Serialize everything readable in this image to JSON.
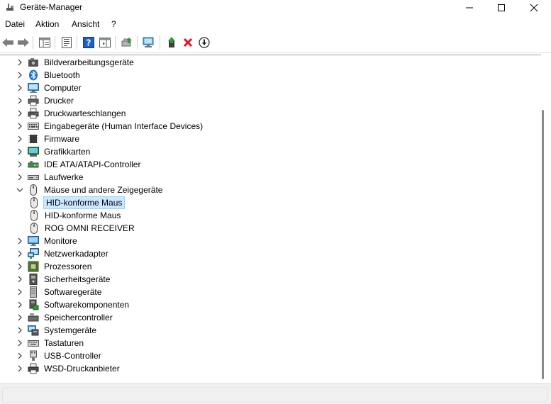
{
  "window": {
    "title": "Geräte-Manager"
  },
  "menu": [
    {
      "label": "Datei"
    },
    {
      "label": "Aktion"
    },
    {
      "label": "Ansicht"
    },
    {
      "label": "?"
    }
  ],
  "toolbar": {
    "buttons": [
      {
        "icon": "back-arrow-icon"
      },
      {
        "icon": "forward-arrow-icon"
      },
      {
        "icon": "show-hide-console-tree-icon"
      },
      {
        "icon": "properties-icon"
      },
      {
        "icon": "help-icon"
      },
      {
        "icon": "action-pane-icon"
      },
      {
        "icon": "update-driver-icon"
      },
      {
        "icon": "scan-hardware-icon"
      },
      {
        "icon": "enable-device-icon"
      },
      {
        "icon": "uninstall-device-icon"
      },
      {
        "icon": "disable-device-icon"
      }
    ]
  },
  "tree": [
    {
      "label": "Bildverarbeitungsgeräte",
      "icon": "camera-icon",
      "expanded": false,
      "level": 0
    },
    {
      "label": "Bluetooth",
      "icon": "bluetooth-icon",
      "expanded": false,
      "level": 0
    },
    {
      "label": "Computer",
      "icon": "computer-icon",
      "expanded": false,
      "level": 0
    },
    {
      "label": "Drucker",
      "icon": "printer-icon",
      "expanded": false,
      "level": 0
    },
    {
      "label": "Druckwarteschlangen",
      "icon": "print-queue-icon",
      "expanded": false,
      "level": 0
    },
    {
      "label": "Eingabegeräte (Human Interface Devices)",
      "icon": "keyboard-hid-icon",
      "expanded": false,
      "level": 0
    },
    {
      "label": "Firmware",
      "icon": "chip-icon",
      "expanded": false,
      "level": 0
    },
    {
      "label": "Grafikkarten",
      "icon": "display-adapter-icon",
      "expanded": false,
      "level": 0
    },
    {
      "label": "IDE ATA/ATAPI-Controller",
      "icon": "ide-controller-icon",
      "expanded": false,
      "level": 0
    },
    {
      "label": "Laufwerke",
      "icon": "disk-drive-icon",
      "expanded": false,
      "level": 0
    },
    {
      "label": "Mäuse und andere Zeigegeräte",
      "icon": "mouse-icon",
      "expanded": true,
      "level": 0
    },
    {
      "label": "HID-konforme Maus",
      "icon": "mouse-icon",
      "level": 1,
      "selected": true
    },
    {
      "label": "HID-konforme Maus",
      "icon": "mouse-icon",
      "level": 1
    },
    {
      "label": "ROG OMNI RECEIVER",
      "icon": "mouse-icon",
      "level": 1
    },
    {
      "label": "Monitore",
      "icon": "monitor-icon",
      "expanded": false,
      "level": 0
    },
    {
      "label": "Netzwerkadapter",
      "icon": "network-adapter-icon",
      "expanded": false,
      "level": 0
    },
    {
      "label": "Prozessoren",
      "icon": "processor-icon",
      "expanded": false,
      "level": 0
    },
    {
      "label": "Sicherheitsgeräte",
      "icon": "security-device-icon",
      "expanded": false,
      "level": 0
    },
    {
      "label": "Softwaregeräte",
      "icon": "software-device-icon",
      "expanded": false,
      "level": 0
    },
    {
      "label": "Softwarekomponenten",
      "icon": "software-component-icon",
      "expanded": false,
      "level": 0
    },
    {
      "label": "Speichercontroller",
      "icon": "storage-controller-icon",
      "expanded": false,
      "level": 0
    },
    {
      "label": "Systemgeräte",
      "icon": "system-device-icon",
      "expanded": false,
      "level": 0
    },
    {
      "label": "Tastaturen",
      "icon": "keyboard-icon",
      "expanded": false,
      "level": 0
    },
    {
      "label": "USB-Controller",
      "icon": "usb-icon",
      "expanded": false,
      "level": 0
    },
    {
      "label": "WSD-Druckanbieter",
      "icon": "wsd-printer-icon",
      "expanded": false,
      "level": 0
    }
  ],
  "colors": {
    "selection_bg": "#cce8ff",
    "selection_border": "#99d1ff",
    "uninstall_red": "#e81123",
    "update_green": "#2e9b2e"
  }
}
